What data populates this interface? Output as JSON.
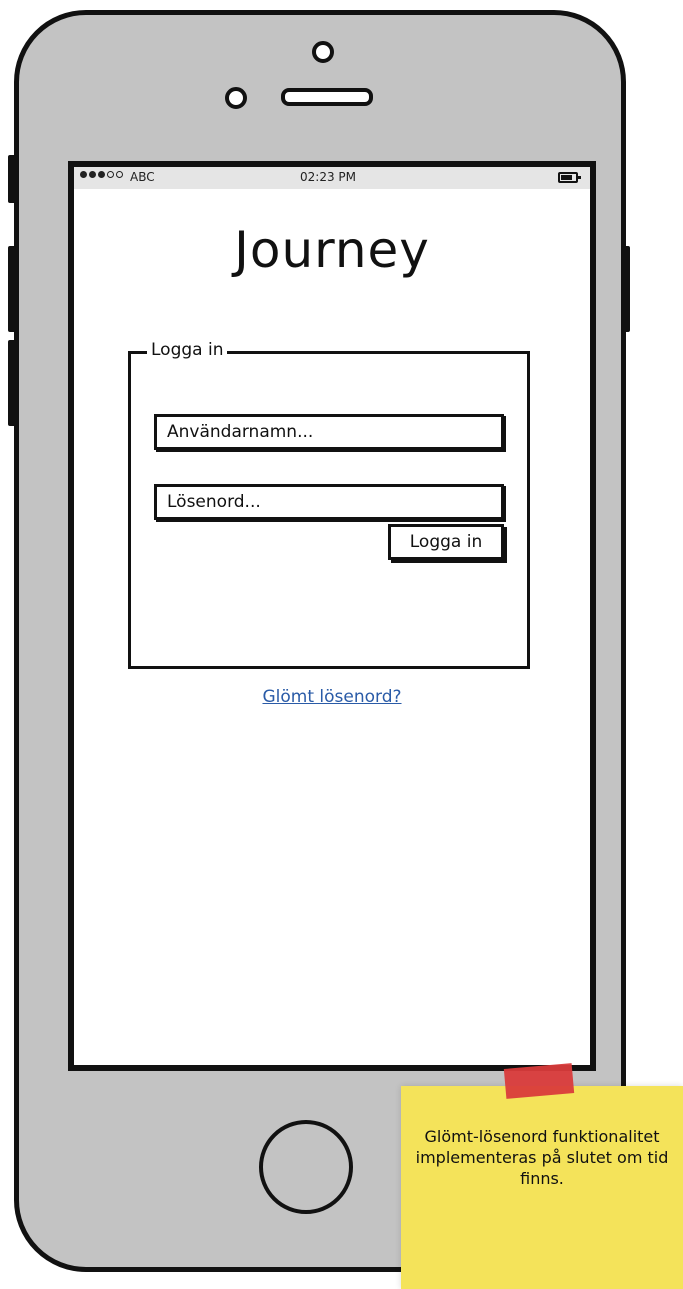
{
  "statusbar": {
    "carrier": "ABC",
    "time": "02:23 PM",
    "signal_icon": "signal-dots-icon",
    "battery_icon": "battery-icon"
  },
  "app": {
    "title": "Journey"
  },
  "login": {
    "legend": "Logga in",
    "username_placeholder": "Användarnamn...",
    "password_placeholder": "Lösenord...",
    "submit_label": "Logga in",
    "forgot_link": "Glömt lösenord?"
  },
  "sticky_note": {
    "text": "Glömt-lösenord funktionalitet implementeras på slutet om tid finns.",
    "color": "#f4e35a",
    "tape_color": "#d93b3b"
  },
  "colors": {
    "link": "#2a5ba7",
    "phone_body": "#c3c3c3"
  }
}
